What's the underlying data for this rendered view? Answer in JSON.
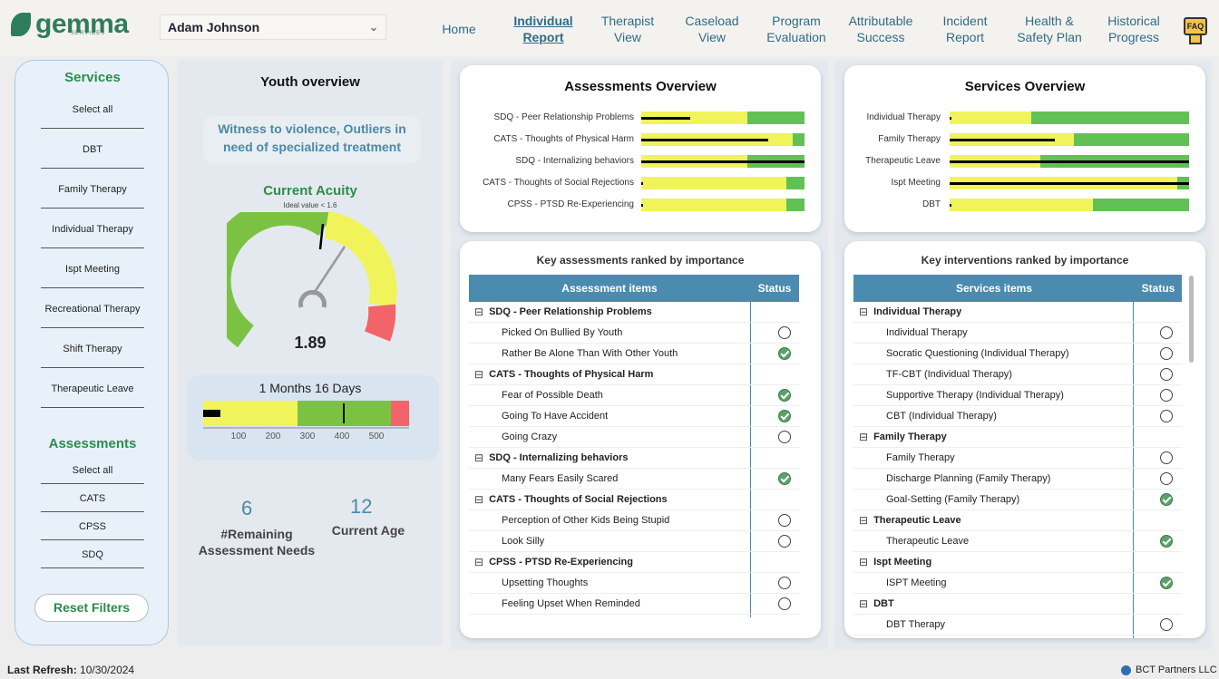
{
  "header": {
    "logo_text": "gemma",
    "logo_sub": "SERVICES",
    "user_name": "Adam Johnson",
    "nav": [
      {
        "label": "Home",
        "active": false
      },
      {
        "label": "Individual\nReport",
        "active": true
      },
      {
        "label": "Therapist\nView",
        "active": false
      },
      {
        "label": "Caseload\nView",
        "active": false
      },
      {
        "label": "Program\nEvaluation",
        "active": false
      },
      {
        "label": "Attributable\nSuccess",
        "active": false
      },
      {
        "label": "Incident\nReport",
        "active": false
      },
      {
        "label": "Health &\nSafety Plan",
        "active": false
      },
      {
        "label": "Historical\nProgress",
        "active": false
      }
    ],
    "faq_label": "FAQ"
  },
  "services": {
    "title": "Services",
    "items": [
      "Select all",
      "DBT",
      "Family Therapy",
      "Individual Therapy",
      "Ispt Meeting",
      "Recreational Therapy",
      "Shift Therapy",
      "Therapeutic Leave"
    ]
  },
  "assessments_filter": {
    "title": "Assessments",
    "items": [
      "Select all",
      "CATS",
      "CPSS",
      "SDQ"
    ]
  },
  "reset_label": "Reset Filters",
  "youth": {
    "title": "Youth overview",
    "tags": "Witness to violence, Outliers in need of specialized treatment",
    "acuity_title": "Current Acuity",
    "acuity_ideal": "Ideal value < 1.6",
    "acuity_value": "1.89",
    "duration": "1 Months 16 Days",
    "duration_ticks": [
      "100",
      "200",
      "300",
      "400",
      "500"
    ],
    "remaining_value": "6",
    "remaining_label": "#Remaining Assessment Needs",
    "age_value": "12",
    "age_label": "Current Age"
  },
  "assessments_overview": {
    "title": "Assessments Overview",
    "bars": [
      {
        "label": "SDQ - Peer Relationship Problems",
        "value": 0.3,
        "yellow_end": 0.65
      },
      {
        "label": "CATS - Thoughts of Physical Harm",
        "value": 0.78,
        "yellow_end": 0.93
      },
      {
        "label": "SDQ - Internalizing behaviors",
        "value": 1.0,
        "yellow_end": 0.65
      },
      {
        "label": "CATS - Thoughts of Social Rejections",
        "value": 0.0,
        "yellow_end": 0.89
      },
      {
        "label": "CPSS - PTSD Re-Experiencing",
        "value": 0.0,
        "yellow_end": 0.89
      }
    ]
  },
  "services_overview": {
    "title": "Services Overview",
    "bars": [
      {
        "label": "Individual Therapy",
        "value": 0.0,
        "yellow_end": 0.34
      },
      {
        "label": "Family Therapy",
        "value": 0.44,
        "yellow_end": 0.52
      },
      {
        "label": "Therapeutic Leave",
        "value": 1.0,
        "yellow_end": 0.38
      },
      {
        "label": "Ispt Meeting",
        "value": 1.0,
        "yellow_end": 0.95
      },
      {
        "label": "DBT",
        "value": 0.0,
        "yellow_end": 0.6
      }
    ]
  },
  "key_assessments": {
    "title": "Key assessments ranked by importance",
    "col1": "Assessment items",
    "col2": "Status",
    "rows": [
      {
        "type": "group",
        "label": "SDQ - Peer Relationship Problems"
      },
      {
        "type": "item",
        "label": "Picked On Bullied By Youth",
        "done": false
      },
      {
        "type": "item",
        "label": "Rather Be Alone Than With Other Youth",
        "done": true
      },
      {
        "type": "group",
        "label": "CATS - Thoughts of Physical Harm"
      },
      {
        "type": "item",
        "label": "Fear of Possible Death",
        "done": true
      },
      {
        "type": "item",
        "label": "Going To Have Accident",
        "done": true
      },
      {
        "type": "item",
        "label": "Going Crazy",
        "done": false
      },
      {
        "type": "group",
        "label": "SDQ - Internalizing behaviors"
      },
      {
        "type": "item",
        "label": "Many Fears Easily Scared",
        "done": true
      },
      {
        "type": "group",
        "label": "CATS - Thoughts of Social Rejections"
      },
      {
        "type": "item",
        "label": "Perception of Other Kids Being Stupid",
        "done": false
      },
      {
        "type": "item",
        "label": "Look Silly",
        "done": false
      },
      {
        "type": "group",
        "label": "CPSS - PTSD Re-Experiencing"
      },
      {
        "type": "item",
        "label": "Upsetting Thoughts",
        "done": false
      },
      {
        "type": "item",
        "label": "Feeling Upset When Reminded",
        "done": false
      }
    ]
  },
  "key_interventions": {
    "title": "Key interventions ranked by importance",
    "col1": "Services items",
    "col2": "Status",
    "rows": [
      {
        "type": "group",
        "label": "Individual Therapy"
      },
      {
        "type": "item",
        "label": "Individual Therapy",
        "done": false
      },
      {
        "type": "item",
        "label": "Socratic Questioning (Individual Therapy)",
        "done": false
      },
      {
        "type": "item",
        "label": "TF-CBT (Individual Therapy)",
        "done": false
      },
      {
        "type": "item",
        "label": "Supportive Therapy (Individual Therapy)",
        "done": false
      },
      {
        "type": "item",
        "label": "CBT (Individual Therapy)",
        "done": false
      },
      {
        "type": "group",
        "label": "Family Therapy"
      },
      {
        "type": "item",
        "label": "Family Therapy",
        "done": false
      },
      {
        "type": "item",
        "label": "Discharge Planning (Family Therapy)",
        "done": false
      },
      {
        "type": "item",
        "label": "Goal-Setting (Family Therapy)",
        "done": true
      },
      {
        "type": "group",
        "label": "Therapeutic Leave"
      },
      {
        "type": "item",
        "label": "Therapeutic Leave",
        "done": true
      },
      {
        "type": "group",
        "label": "Ispt Meeting"
      },
      {
        "type": "item",
        "label": "ISPT Meeting",
        "done": true
      },
      {
        "type": "group",
        "label": "DBT"
      },
      {
        "type": "item",
        "label": "DBT Therapy",
        "done": false
      }
    ]
  },
  "footer": {
    "refresh_label": "Last Refresh:",
    "refresh_date": "10/30/2024",
    "company": "BCT Partners LLC"
  },
  "colors": {
    "accent_green": "#2c8c4a",
    "blue": "#4b8bb0",
    "bar_yellow": "#f0f45a",
    "bar_green": "#62c155"
  }
}
